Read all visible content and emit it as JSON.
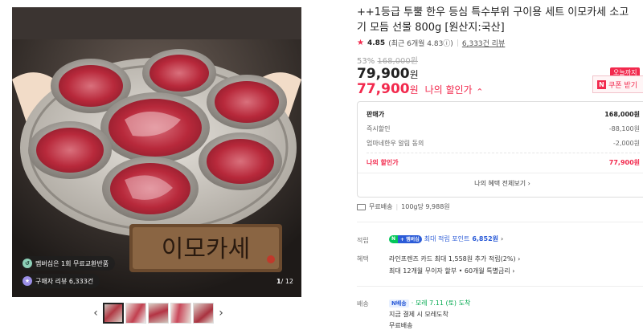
{
  "gallery": {
    "badge_membership": "멤버십은 1회 무료교환반품",
    "badge_membership_icon": "refresh-icon",
    "badge_reviews": "구매자 리뷰 6,333건",
    "badge_reviews_icon": "review-icon",
    "counter_current": "1",
    "counter_total": "/ 12",
    "sign_text": "이모카세",
    "prev_arrow": "‹",
    "next_arrow": "›",
    "thumbnail_count": 5
  },
  "product": {
    "title": "++1등급 투뿔 한우 등심 특수부위 구이용 세트 이모카세 소고기 모듬 선물 800g [원산지:국산]",
    "rating": "4.85",
    "rating_recent": "(최근 6개월 4.83ⓘ)",
    "reviews": "6,333건 리뷰",
    "discount_pct": "53%",
    "original_price": "168,000원",
    "price": "79,900",
    "price_unit": "원",
    "my_price": "77,900",
    "my_price_unit": "원",
    "my_price_label": "나의 할인가",
    "today_badge": "오늘까지",
    "coupon_label": "쿠폰 받기",
    "coupon_icon": "N"
  },
  "breakdown": {
    "rows": [
      {
        "label": "판매가",
        "value": "168,000원"
      },
      {
        "label": "즉시할인",
        "value": "-88,100원"
      },
      {
        "label": "엄마네한우 알림 동의",
        "value": "-2,000원"
      }
    ],
    "final_label": "나의 할인가",
    "final_value": "77,900원",
    "more_label": "나의 혜택 전체보기 ›"
  },
  "shipping": {
    "free": "무료배송",
    "unit_price": "100g당 9,988원"
  },
  "points": {
    "label": "적립",
    "npay_n": "N",
    "npay_pay": "+ 멤버십",
    "text": "최대 적립 포인트",
    "amount": "6,852원",
    "chevron": "›"
  },
  "benefits": {
    "label": "혜택",
    "line1": "라인프렌즈 카드 최대 1,558원 추가 적립(2%) ›",
    "line2": "최대 12개월 무이자 할부 • 60개월 특별금리 ›"
  },
  "delivery": {
    "label": "배송",
    "badge": "N배송",
    "eta": "· 모레 7.11 (토) 도착",
    "line2": "지금 결제 시 모레도착",
    "line3": "무료배송"
  },
  "colors": {
    "accent_red": "#f2294d",
    "npay_green": "#03c75a",
    "link_blue": "#2b5bd7"
  }
}
